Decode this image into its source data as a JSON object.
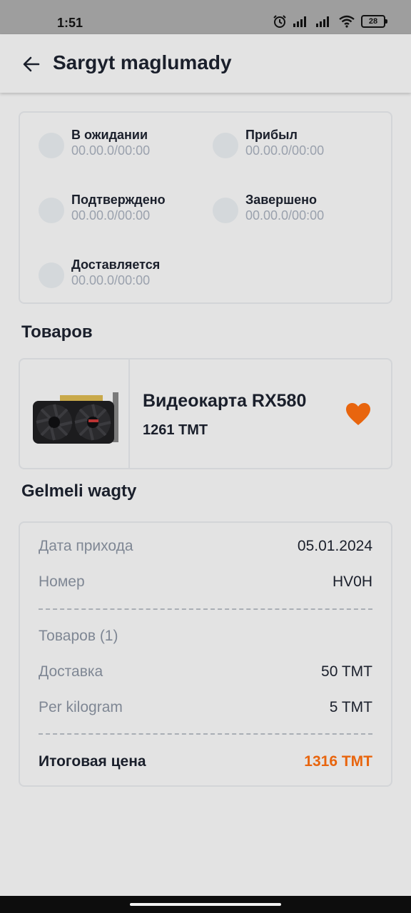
{
  "status_bar": {
    "time": "1:51",
    "battery": "28"
  },
  "app_bar": {
    "title": "Sargyt maglumady",
    "back_icon": "arrow-left-icon"
  },
  "order_statuses": [
    {
      "label": "В ожидании",
      "time": "00.00.0/00:00"
    },
    {
      "label": "Прибыл",
      "time": "00.00.0/00:00"
    },
    {
      "label": "Подтверждено",
      "time": "00.00.0/00:00"
    },
    {
      "label": "Завершено",
      "time": "00.00.0/00:00"
    },
    {
      "label": "Доставляется",
      "time": "00.00.0/00:00"
    }
  ],
  "products_section": {
    "title": "Товаров"
  },
  "product": {
    "name": "Видеокарта RX580",
    "price": "1261 TMT",
    "favorite_icon": "heart-icon",
    "favorite_color": "#e8650e"
  },
  "delivery_section": {
    "title": "Gelmeli wagty"
  },
  "summary": {
    "arrival_date_label": "Дата прихода",
    "arrival_date_value": "05.01.2024",
    "number_label": "Номер",
    "number_value": "HV0H",
    "items_label": "Товаров (1)",
    "delivery_label": "Доставка",
    "delivery_value": "50 TMT",
    "per_kg_label": "Per kilogram",
    "per_kg_value": "5 TMT",
    "total_label": "Итоговая цена",
    "total_value": "1316 TMT"
  },
  "colors": {
    "accent": "#e8650e",
    "background": "#e3e3e3",
    "muted_text": "#7f8794"
  }
}
